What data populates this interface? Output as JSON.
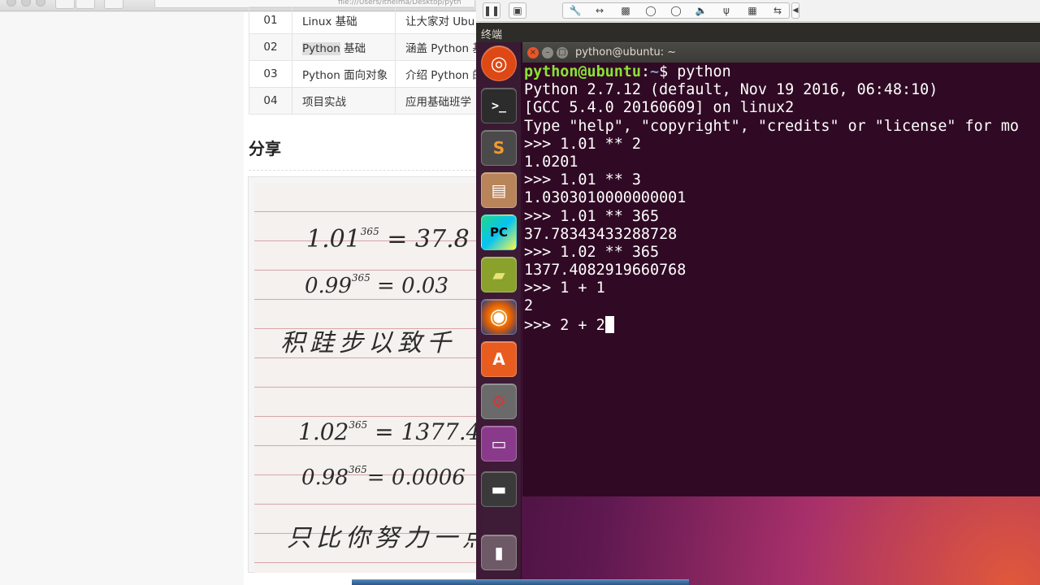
{
  "browser": {
    "url": "file:///Users/itheima/Desktop/pyth"
  },
  "course_table": {
    "rows": [
      {
        "num": "01",
        "name": "Linux 基础",
        "desc": "让大家对 Ubu"
      },
      {
        "num": "02",
        "name_highlight": "Python",
        "name_rest": " 基础",
        "desc": "涵盖 Python 基"
      },
      {
        "num": "03",
        "name": "Python 面向对象",
        "desc": "介绍 Python 的"
      },
      {
        "num": "04",
        "name": "项目实战",
        "desc": "应用基础班学"
      }
    ]
  },
  "share": {
    "title": "分享",
    "note_lines": [
      {
        "base": "1.01",
        "exp": "365",
        "rest": " = 37.8"
      },
      {
        "base": "0.99",
        "exp": "365",
        "rest": " = 0.03"
      },
      {
        "text": "积跬步以致千"
      },
      {
        "base": "1.02",
        "exp": "365",
        "rest": " = 1377.4"
      },
      {
        "base": "0.98",
        "exp": "365",
        "rest": "= 0.0006"
      },
      {
        "text": "只比你努力一点"
      }
    ]
  },
  "vm_toolbar": {
    "pause_icon": "pause-icon",
    "snapshot_icon": "snapshot-icon",
    "icons": [
      "wrench-icon",
      "resize-icon",
      "capture-icon",
      "disk-icon",
      "disk2-icon",
      "audio-icon",
      "usb-icon",
      "save-icon",
      "network-icon",
      "collapse-icon"
    ]
  },
  "ubuntu": {
    "topbar_title": "终端",
    "launcher_items": [
      "ubuntu-dash-icon",
      "terminal-icon",
      "sublime-icon",
      "files-icon",
      "pycharm-icon",
      "book-icon",
      "firefox-icon",
      "software-center-icon",
      "settings-icon",
      "workspace-icon",
      "floppy-icon",
      "trash-icon"
    ],
    "launcher_glyphs": {
      "ubuntu": "◎",
      "terminal": ">_",
      "sublime": "S",
      "files": "▤",
      "pycharm": "PC",
      "book": "▰",
      "firefox": "◉",
      "software": "A",
      "settings": "⚙",
      "workspace": "▭",
      "floppy": "▬",
      "trash": "▮"
    }
  },
  "terminal": {
    "window_title": "python@ubuntu: ~",
    "prompt_user": "python@ubuntu",
    "prompt_sep": ":",
    "prompt_path": "~",
    "prompt_end": "$ python",
    "lines": [
      "Python 2.7.12 (default, Nov 19 2016, 06:48:10)",
      "[GCC 5.4.0 20160609] on linux2",
      "Type \"help\", \"copyright\", \"credits\" or \"license\" for mo",
      ">>> 1.01 ** 2",
      "1.0201",
      ">>> 1.01 ** 3",
      "1.0303010000000001",
      ">>> 1.01 ** 365",
      "37.78343433288728",
      ">>> 1.02 ** 365",
      "1377.4082919660768",
      ">>> 1 + 1",
      "2"
    ],
    "current_input": ">>> 2 + 2"
  },
  "colors": {
    "terminal_bg": "#300a24",
    "prompt_green": "#8ae234",
    "prompt_blue": "#729fcf"
  }
}
